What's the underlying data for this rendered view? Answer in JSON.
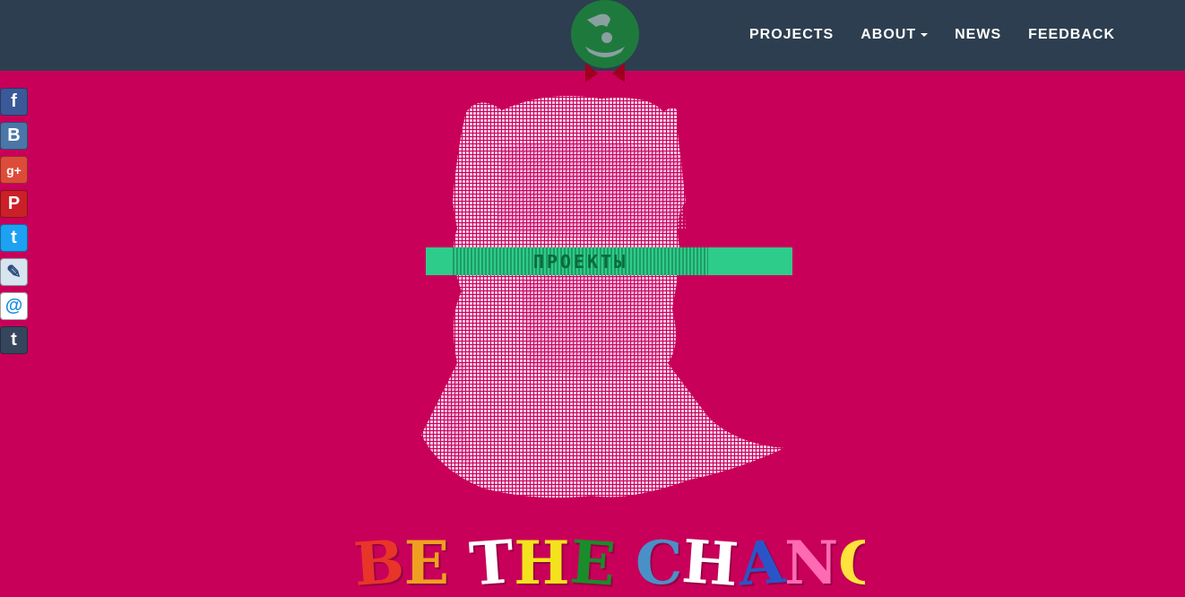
{
  "nav": {
    "items": [
      {
        "label": "PROJECTS",
        "has_caret": false
      },
      {
        "label": "ABOUT",
        "has_caret": true
      },
      {
        "label": "NEWS",
        "has_caret": false
      },
      {
        "label": "FEEDBACK",
        "has_caret": false
      }
    ]
  },
  "logo": {
    "icon": "hand-coin-icon",
    "colors": {
      "circle": "#1e7a3c",
      "ribbon": "#a0001e",
      "glyph": "#8aa0a0"
    }
  },
  "social": [
    {
      "name": "facebook-icon",
      "glyph": "f",
      "color": "#3b5998"
    },
    {
      "name": "vk-icon",
      "glyph": "B",
      "color": "#4a76a8"
    },
    {
      "name": "google-plus-icon",
      "glyph": "g+",
      "color": "#dd4b39"
    },
    {
      "name": "pinterest-icon",
      "glyph": "P",
      "color": "#cb2027"
    },
    {
      "name": "twitter-icon",
      "glyph": "t",
      "color": "#1da1f2"
    },
    {
      "name": "livejournal-icon",
      "glyph": "✎",
      "color": "#d8e4ef"
    },
    {
      "name": "mail-icon",
      "glyph": "@",
      "color": "#168de2"
    },
    {
      "name": "tumblr-icon",
      "glyph": "t",
      "color": "#35465c"
    }
  ],
  "hero": {
    "title_text": "ПРОЕКТЫ",
    "tagline": "BE THE CHANGE",
    "tagline_colors": [
      "#e8352a",
      "#f0a020",
      "#ffffff",
      "#f4e21d",
      "#1a8c2a",
      "#4a90c8",
      "#ffffff",
      "#2a55c8",
      "#ff6ab4",
      "#ffe23b",
      "#e8352a",
      "#ff9f1c",
      "#1a8c2a"
    ]
  }
}
